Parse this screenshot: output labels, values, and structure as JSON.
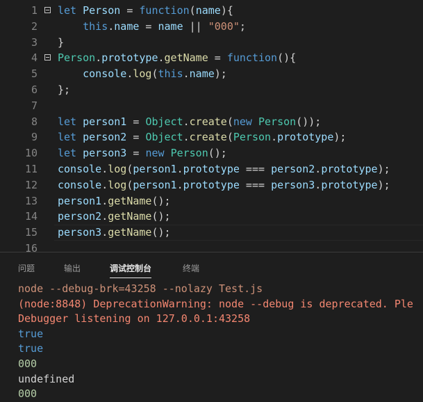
{
  "editor": {
    "lines": [
      {
        "n": "1",
        "fold": true,
        "tokens": [
          [
            "kw",
            "let "
          ],
          [
            "var",
            "Person"
          ],
          [
            "pun",
            " = "
          ],
          [
            "kw",
            "function"
          ],
          [
            "pun",
            "("
          ],
          [
            "var",
            "name"
          ],
          [
            "pun",
            "){"
          ]
        ]
      },
      {
        "n": "2",
        "fold": false,
        "tokens": [
          [
            "pun",
            "    "
          ],
          [
            "kw",
            "this"
          ],
          [
            "pun",
            "."
          ],
          [
            "var",
            "name"
          ],
          [
            "pun",
            " = "
          ],
          [
            "var",
            "name"
          ],
          [
            "pun",
            " || "
          ],
          [
            "str",
            "\"000\""
          ],
          [
            "pun",
            ";"
          ]
        ]
      },
      {
        "n": "3",
        "fold": false,
        "tokens": [
          [
            "pun",
            "}"
          ]
        ]
      },
      {
        "n": "4",
        "fold": true,
        "tokens": [
          [
            "cls",
            "Person"
          ],
          [
            "pun",
            "."
          ],
          [
            "var",
            "prototype"
          ],
          [
            "pun",
            "."
          ],
          [
            "fn",
            "getName"
          ],
          [
            "pun",
            " = "
          ],
          [
            "kw",
            "function"
          ],
          [
            "pun",
            "(){"
          ]
        ]
      },
      {
        "n": "5",
        "fold": false,
        "tokens": [
          [
            "pun",
            "    "
          ],
          [
            "var",
            "console"
          ],
          [
            "pun",
            "."
          ],
          [
            "fn",
            "log"
          ],
          [
            "pun",
            "("
          ],
          [
            "kw",
            "this"
          ],
          [
            "pun",
            "."
          ],
          [
            "var",
            "name"
          ],
          [
            "pun",
            ");"
          ]
        ]
      },
      {
        "n": "6",
        "fold": false,
        "tokens": [
          [
            "pun",
            "};"
          ]
        ]
      },
      {
        "n": "7",
        "fold": false,
        "tokens": []
      },
      {
        "n": "8",
        "fold": false,
        "tokens": [
          [
            "kw",
            "let "
          ],
          [
            "var",
            "person1"
          ],
          [
            "pun",
            " = "
          ],
          [
            "cls",
            "Object"
          ],
          [
            "pun",
            "."
          ],
          [
            "fn",
            "create"
          ],
          [
            "pun",
            "("
          ],
          [
            "kw",
            "new "
          ],
          [
            "cls",
            "Person"
          ],
          [
            "pun",
            "());"
          ]
        ]
      },
      {
        "n": "9",
        "fold": false,
        "tokens": [
          [
            "kw",
            "let "
          ],
          [
            "var",
            "person2"
          ],
          [
            "pun",
            " = "
          ],
          [
            "cls",
            "Object"
          ],
          [
            "pun",
            "."
          ],
          [
            "fn",
            "create"
          ],
          [
            "pun",
            "("
          ],
          [
            "cls",
            "Person"
          ],
          [
            "pun",
            "."
          ],
          [
            "var",
            "prototype"
          ],
          [
            "pun",
            ");"
          ]
        ]
      },
      {
        "n": "10",
        "fold": false,
        "tokens": [
          [
            "kw",
            "let "
          ],
          [
            "var",
            "person3"
          ],
          [
            "pun",
            " = "
          ],
          [
            "kw",
            "new "
          ],
          [
            "cls",
            "Person"
          ],
          [
            "pun",
            "();"
          ]
        ]
      },
      {
        "n": "11",
        "fold": false,
        "tokens": [
          [
            "var",
            "console"
          ],
          [
            "pun",
            "."
          ],
          [
            "fn",
            "log"
          ],
          [
            "pun",
            "("
          ],
          [
            "var",
            "person1"
          ],
          [
            "pun",
            "."
          ],
          [
            "var",
            "prototype"
          ],
          [
            "pun",
            " === "
          ],
          [
            "var",
            "person2"
          ],
          [
            "pun",
            "."
          ],
          [
            "var",
            "prototype"
          ],
          [
            "pun",
            ");"
          ]
        ]
      },
      {
        "n": "12",
        "fold": false,
        "tokens": [
          [
            "var",
            "console"
          ],
          [
            "pun",
            "."
          ],
          [
            "fn",
            "log"
          ],
          [
            "pun",
            "("
          ],
          [
            "var",
            "person1"
          ],
          [
            "pun",
            "."
          ],
          [
            "var",
            "prototype"
          ],
          [
            "pun",
            " === "
          ],
          [
            "var",
            "person3"
          ],
          [
            "pun",
            "."
          ],
          [
            "var",
            "prototype"
          ],
          [
            "pun",
            ");"
          ]
        ]
      },
      {
        "n": "13",
        "fold": false,
        "tokens": [
          [
            "var",
            "person1"
          ],
          [
            "pun",
            "."
          ],
          [
            "fn",
            "getName"
          ],
          [
            "pun",
            "();"
          ]
        ]
      },
      {
        "n": "14",
        "fold": false,
        "tokens": [
          [
            "var",
            "person2"
          ],
          [
            "pun",
            "."
          ],
          [
            "fn",
            "getName"
          ],
          [
            "pun",
            "();"
          ]
        ]
      },
      {
        "n": "15",
        "fold": false,
        "current": true,
        "tokens": [
          [
            "var",
            "person3"
          ],
          [
            "pun",
            "."
          ],
          [
            "fn",
            "getName"
          ],
          [
            "pun",
            "();"
          ]
        ]
      },
      {
        "n": "16",
        "fold": false,
        "tokens": []
      }
    ]
  },
  "panel": {
    "tabs": [
      {
        "label": "问题",
        "active": false
      },
      {
        "label": "输出",
        "active": false
      },
      {
        "label": "调试控制台",
        "active": true
      },
      {
        "label": "终端",
        "active": false
      }
    ],
    "output": [
      {
        "text": "node --debug-brk=43258 --nolazy Test.js",
        "style": "o-orange"
      },
      {
        "text": "(node:8848) DeprecationWarning: node --debug is deprecated. Ple",
        "style": "o-red"
      },
      {
        "text": "Debugger listening on 127.0.0.1:43258",
        "style": "o-red"
      },
      {
        "text": "true",
        "style": "o-blue"
      },
      {
        "text": "true",
        "style": "o-blue"
      },
      {
        "text": "000",
        "style": "o-num"
      },
      {
        "text": "undefined",
        "style": "o-plain"
      },
      {
        "text": "000",
        "style": "o-num"
      }
    ]
  }
}
